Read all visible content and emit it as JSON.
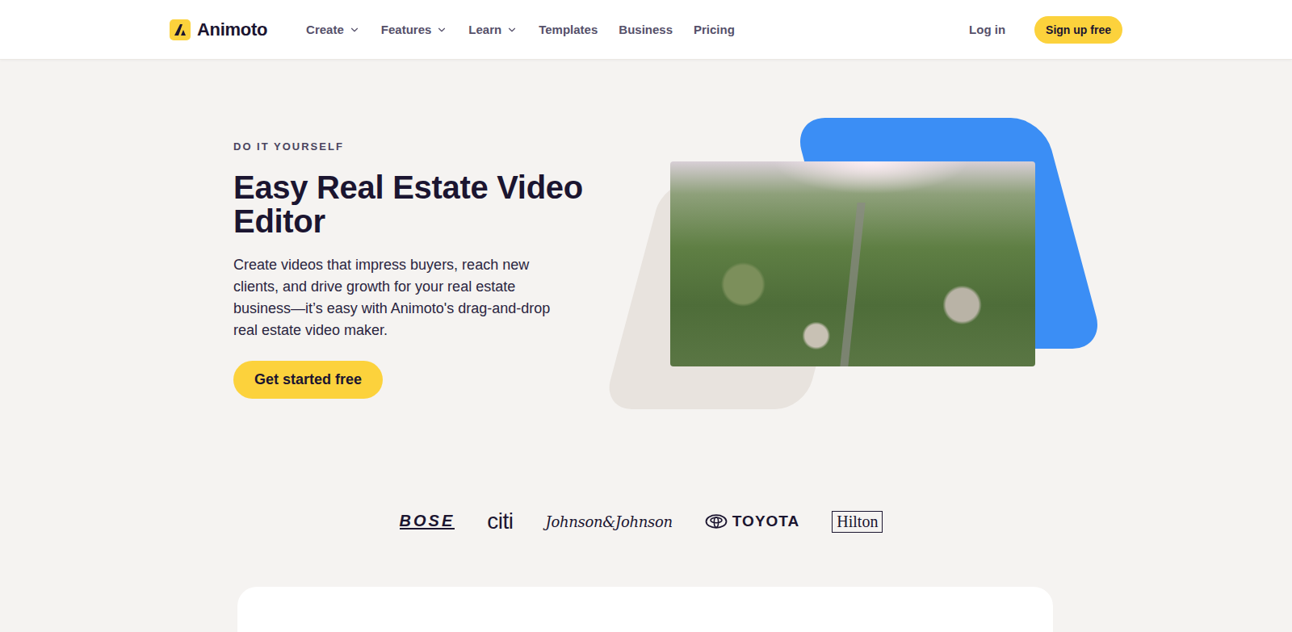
{
  "header": {
    "logo": "Animoto",
    "nav": [
      {
        "label": "Create",
        "dropdown": true
      },
      {
        "label": "Features",
        "dropdown": true
      },
      {
        "label": "Learn",
        "dropdown": true
      },
      {
        "label": "Templates",
        "dropdown": false
      },
      {
        "label": "Business",
        "dropdown": false
      },
      {
        "label": "Pricing",
        "dropdown": false
      }
    ],
    "login": "Log in",
    "signup": "Sign up free"
  },
  "hero": {
    "eyebrow": "DO IT YOURSELF",
    "title": "Easy Real Estate Video Editor",
    "description": "Create videos that impress buyers, reach new clients, and drive growth for your real estate business—it’s easy with Animoto's drag-and-drop real estate video maker.",
    "cta": "Get started free"
  },
  "brands": [
    {
      "name": "BOSE",
      "kind": "bose"
    },
    {
      "name": "citi",
      "kind": "citi"
    },
    {
      "name": "Johnson&Johnson",
      "kind": "jnj"
    },
    {
      "name": "TOYOTA",
      "kind": "toyota"
    },
    {
      "name": "Hilton",
      "kind": "hilton"
    }
  ]
}
